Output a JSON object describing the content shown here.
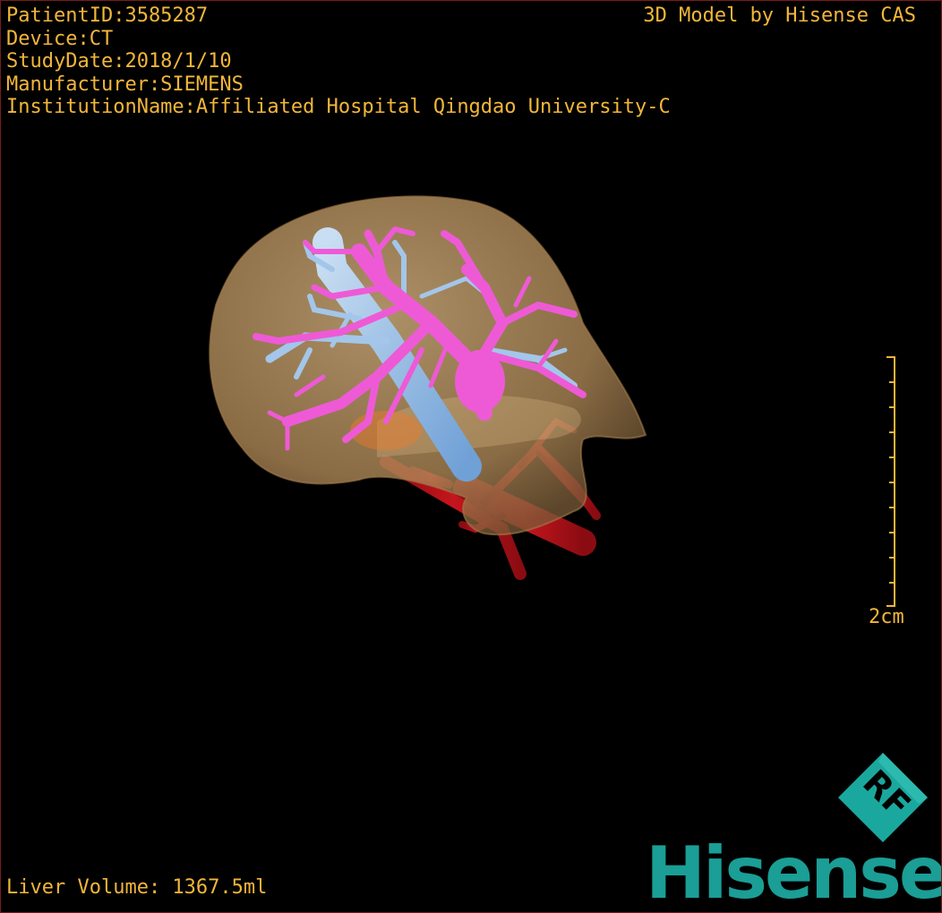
{
  "info": {
    "patient_id": "PatientID:3585287",
    "device": "Device:CT",
    "study_date": "StudyDate:2018/1/10",
    "manufacturer": "Manufacturer:SIEMENS",
    "institution": "InstitutionName:Affiliated Hospital Qingdao University-C"
  },
  "title": "3D Model by Hisense CAS",
  "scale_label": "2cm",
  "liver_volume": "Liver Volume: 1367.5ml",
  "brand": {
    "name": "Hisense",
    "badge_text": "RF"
  },
  "colors": {
    "text": "#f2b63a",
    "background": "#000000",
    "liver": "#c9a06a",
    "portal_vein": "#ee5ad6",
    "hepatic_vein": "#9fc3e8",
    "artery": "#b4121a",
    "brand": "#1a9e96"
  }
}
